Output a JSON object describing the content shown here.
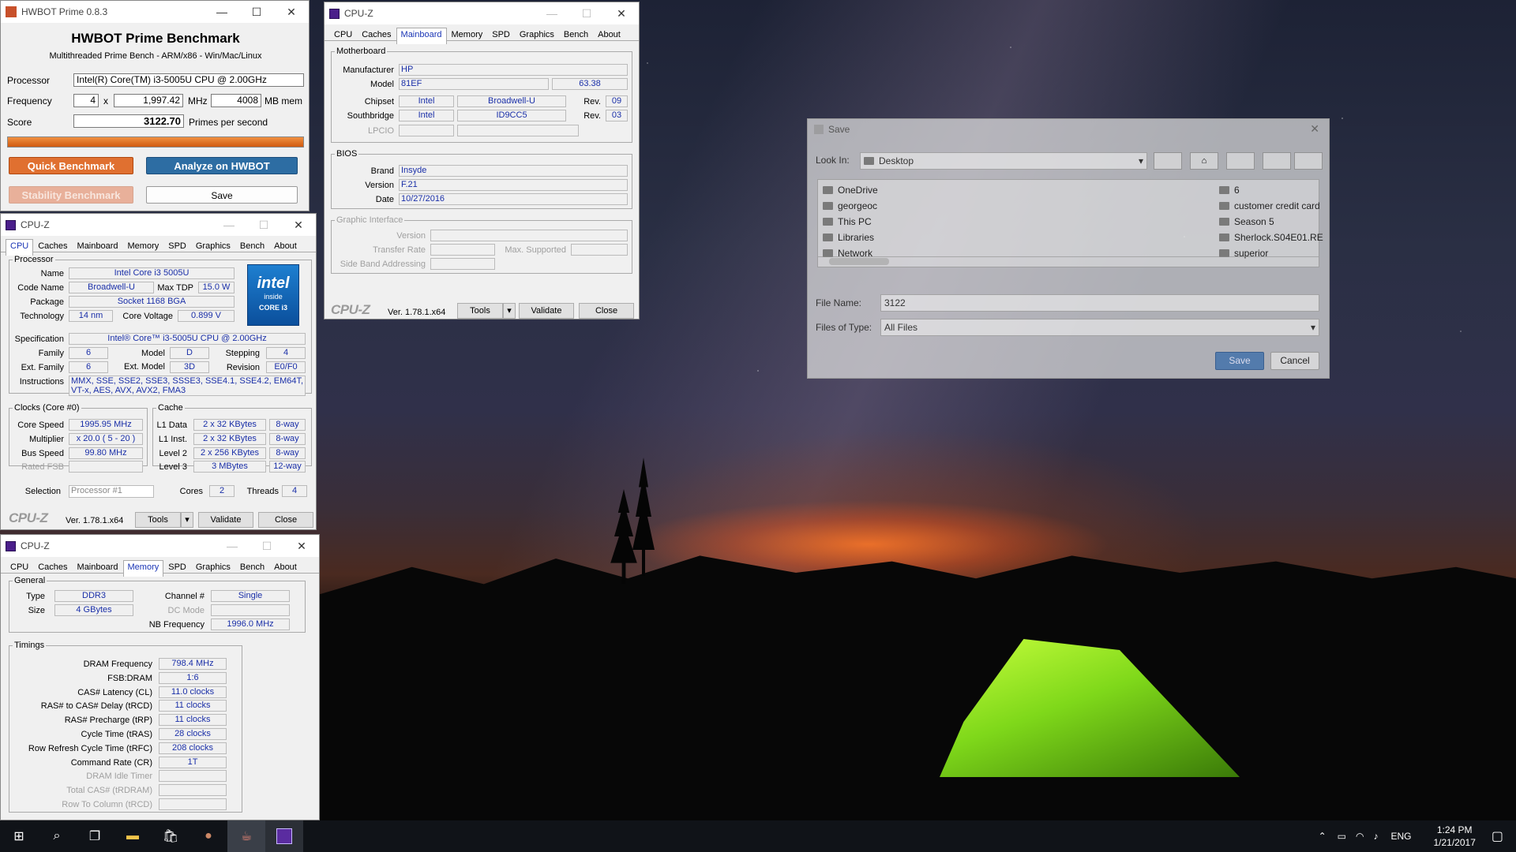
{
  "hwbot": {
    "window_title": "HWBOT Prime 0.8.3",
    "heading": "HWBOT Prime Benchmark",
    "subheading": "Multithreaded Prime Bench - ARM/x86 - Win/Mac/Linux",
    "processor_label": "Processor",
    "processor": "Intel(R) Core(TM) i3-5005U CPU @ 2.00GHz",
    "frequency_label": "Frequency",
    "threads": "4",
    "x_label": "x",
    "frequency": "1,997.42",
    "mhz_label": "MHz",
    "memory": "4008",
    "mem_label": "MB mem",
    "score_label": "Score",
    "score": "3122.70",
    "score_unit": "Primes per second",
    "progress": 1.0,
    "quick_label": "Quick Benchmark",
    "analyze_label": "Analyze on HWBOT",
    "stability_label": "Stability Benchmark",
    "save_label": "Save"
  },
  "cpuz_common": {
    "window_title": "CPU-Z",
    "tabs": [
      "CPU",
      "Caches",
      "Mainboard",
      "Memory",
      "SPD",
      "Graphics",
      "Bench",
      "About"
    ],
    "logo": "CPU-Z",
    "version": "Ver. 1.78.1.x64",
    "tools_label": "Tools",
    "validate_label": "Validate",
    "close_label": "Close"
  },
  "cpu_tab": {
    "processor_legend": "Processor",
    "name_label": "Name",
    "name": "Intel Core i3 5005U",
    "codename_label": "Code Name",
    "codename": "Broadwell-U",
    "maxtdp_label": "Max TDP",
    "maxtdp": "15.0 W",
    "package_label": "Package",
    "package": "Socket 1168 BGA",
    "technology_label": "Technology",
    "technology": "14 nm",
    "corevoltage_label": "Core Voltage",
    "corevoltage": "0.899 V",
    "spec_label": "Specification",
    "spec": "Intel® Core™ i3-5005U CPU @ 2.00GHz",
    "family_label": "Family",
    "family": "6",
    "model_label": "Model",
    "model": "D",
    "stepping_label": "Stepping",
    "stepping": "4",
    "extfamily_label": "Ext. Family",
    "extfamily": "6",
    "extmodel_label": "Ext. Model",
    "extmodel": "3D",
    "revision_label": "Revision",
    "revision": "E0/F0",
    "instructions_label": "Instructions",
    "instructions": "MMX, SSE, SSE2, SSE3, SSSE3, SSE4.1, SSE4.2, EM64T, VT-x, AES, AVX, AVX2, FMA3",
    "logo_brand": "intel",
    "logo_inside": "inside",
    "logo_core": "CORE i3",
    "clocks_legend": "Clocks (Core #0)",
    "corespeed_label": "Core Speed",
    "corespeed": "1995.95 MHz",
    "multiplier_label": "Multiplier",
    "multiplier": "x 20.0 ( 5 - 20 )",
    "busspeed_label": "Bus Speed",
    "busspeed": "99.80 MHz",
    "ratedfsb_label": "Rated FSB",
    "cache_legend": "Cache",
    "l1d_label": "L1 Data",
    "l1d": "2 x 32 KBytes",
    "l1d_way": "8-way",
    "l1i_label": "L1 Inst.",
    "l1i": "2 x 32 KBytes",
    "l1i_way": "8-way",
    "l2_label": "Level 2",
    "l2": "2 x 256 KBytes",
    "l2_way": "8-way",
    "l3_label": "Level 3",
    "l3": "3 MBytes",
    "l3_way": "12-way",
    "selection_label": "Selection",
    "selection": "Processor #1",
    "cores_label": "Cores",
    "cores": "2",
    "threads_label": "Threads",
    "threads": "4"
  },
  "memory_tab": {
    "general_legend": "General",
    "type_label": "Type",
    "type": "DDR3",
    "size_label": "Size",
    "size": "4 GBytes",
    "channel_label": "Channel #",
    "channel": "Single",
    "dcmode_label": "DC Mode",
    "nbfreq_label": "NB Frequency",
    "nbfreq": "1996.0 MHz",
    "timings_legend": "Timings",
    "rows": [
      {
        "label": "DRAM Frequency",
        "value": "798.4 MHz",
        "dim": false
      },
      {
        "label": "FSB:DRAM",
        "value": "1:6",
        "dim": false
      },
      {
        "label": "CAS# Latency (CL)",
        "value": "11.0 clocks",
        "dim": false
      },
      {
        "label": "RAS# to CAS# Delay (tRCD)",
        "value": "11 clocks",
        "dim": false
      },
      {
        "label": "RAS# Precharge (tRP)",
        "value": "11 clocks",
        "dim": false
      },
      {
        "label": "Cycle Time (tRAS)",
        "value": "28 clocks",
        "dim": false
      },
      {
        "label": "Row Refresh Cycle Time (tRFC)",
        "value": "208 clocks",
        "dim": false
      },
      {
        "label": "Command Rate (CR)",
        "value": "1T",
        "dim": false
      },
      {
        "label": "DRAM Idle Timer",
        "value": "",
        "dim": true
      },
      {
        "label": "Total CAS# (tRDRAM)",
        "value": "",
        "dim": true
      },
      {
        "label": "Row To Column (tRCD)",
        "value": "",
        "dim": true
      }
    ]
  },
  "mainboard_tab": {
    "motherboard_legend": "Motherboard",
    "manufacturer_label": "Manufacturer",
    "manufacturer": "HP",
    "model_label": "Model",
    "model": "81EF",
    "model_rev": "63.38",
    "chipset_label": "Chipset",
    "chipset_vendor": "Intel",
    "chipset": "Broadwell-U",
    "rev_label": "Rev.",
    "chipset_rev": "09",
    "southbridge_label": "Southbridge",
    "sb_vendor": "Intel",
    "southbridge": "ID9CC5",
    "sb_rev": "03",
    "lpcio_label": "LPCIO",
    "bios_legend": "BIOS",
    "brand_label": "Brand",
    "brand": "Insyde",
    "version_label": "Version",
    "version": "F.21",
    "date_label": "Date",
    "date": "10/27/2016",
    "gi_legend": "Graphic Interface",
    "gi_version_label": "Version",
    "gi_transfer_label": "Transfer Rate",
    "gi_maxsupported_label": "Max. Supported",
    "gi_sideband_label": "Side Band Addressing"
  },
  "save_dialog": {
    "title": "Save",
    "lookin_label": "Look In:",
    "lookin_value": "Desktop",
    "files_left": [
      "OneDrive",
      "georgeoc",
      "This PC",
      "Libraries",
      "Network"
    ],
    "files_right": [
      "6",
      "customer credit card",
      "Season 5",
      "Sherlock.S04E01.RE",
      "superior"
    ],
    "filename_label": "File Name:",
    "filename": "3122",
    "filetype_label": "Files of Type:",
    "filetype": "All Files",
    "save_label": "Save",
    "cancel_label": "Cancel"
  },
  "taskbar": {
    "language": "ENG",
    "time": "1:24 PM",
    "date": "1/21/2017"
  },
  "colors": {
    "hwbot_orange": "#e06b20",
    "hwbot_blue": "#2a6fa8",
    "cpuz_value_blue": "#1a2fa8"
  }
}
